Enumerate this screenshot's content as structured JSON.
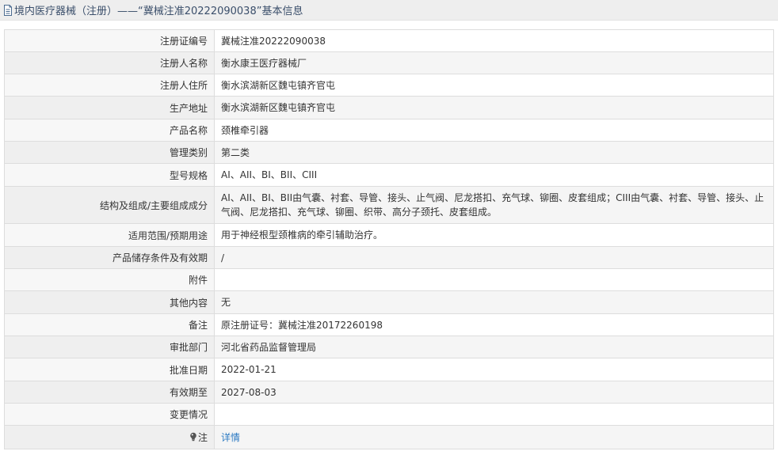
{
  "header": {
    "title": "境内医疗器械（注册）——“冀械注准20222090038”基本信息",
    "icon": "document-icon"
  },
  "rows": [
    {
      "label": "注册证编号",
      "value": "冀械注准20222090038"
    },
    {
      "label": "注册人名称",
      "value": "衡水康王医疗器械厂"
    },
    {
      "label": "注册人住所",
      "value": "衡水滨湖新区魏屯镇齐官屯"
    },
    {
      "label": "生产地址",
      "value": "衡水滨湖新区魏屯镇齐官屯"
    },
    {
      "label": "产品名称",
      "value": "颈椎牵引器"
    },
    {
      "label": "管理类别",
      "value": "第二类"
    },
    {
      "label": "型号规格",
      "value": "AI、AII、BI、BII、CIII"
    },
    {
      "label": "结构及组成/主要组成成分",
      "value": "AI、AII、BI、BII由气囊、衬套、导管、接头、止气阀、尼龙搭扣、充气球、铆圈、皮套组成；CIII由气囊、衬套、导管、接头、止气阀、尼龙搭扣、充气球、铆圈、织带、高分子颈托、皮套组成。"
    },
    {
      "label": "适用范围/预期用途",
      "value": "用于神经根型颈椎病的牵引辅助治疗。"
    },
    {
      "label": "产品储存条件及有效期",
      "value": "/"
    },
    {
      "label": "附件",
      "value": ""
    },
    {
      "label": "其他内容",
      "value": "无"
    },
    {
      "label": "备注",
      "value": "原注册证号：冀械注准20172260198"
    },
    {
      "label": "审批部门",
      "value": "河北省药品监督管理局"
    },
    {
      "label": "批准日期",
      "value": "2022-01-21"
    },
    {
      "label": "有效期至",
      "value": "2027-08-03"
    },
    {
      "label": "变更情况",
      "value": ""
    }
  ],
  "note_row": {
    "label": "注",
    "icon": "lightbulb-icon",
    "link_text": "详情"
  },
  "colors": {
    "header_bg": "#eeeeee",
    "header_text": "#3b4f6b",
    "link": "#2b79c2",
    "border": "#dddddd"
  }
}
